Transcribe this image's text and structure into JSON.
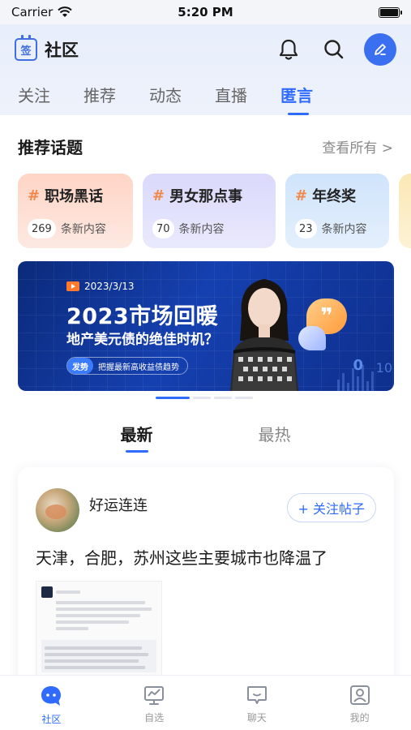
{
  "status_bar": {
    "carrier": "Carrier",
    "time": "5:20 PM"
  },
  "header": {
    "logo_glyph": "签",
    "title": "社区",
    "tabs": [
      "关注",
      "推荐",
      "动态",
      "直播",
      "匿言"
    ],
    "active_tab": "匿言"
  },
  "topics_section": {
    "title": "推荐话题",
    "see_all": "查看所有 >",
    "count_suffix": "条新内容",
    "items": [
      {
        "hash": "#",
        "name": "职场黑话",
        "count": "269"
      },
      {
        "hash": "#",
        "name": "男女那点事",
        "count": "70"
      },
      {
        "hash": "#",
        "name": "年终奖",
        "count": "23"
      }
    ]
  },
  "banner": {
    "date": "2023/3/13",
    "title": "2023市场回暖",
    "subtitle": "地产美元债的绝佳时机？",
    "tag_pill": "发势",
    "tag_text": "把握最新高收益债趋势",
    "bubble_glyph": "❞",
    "digit_a": "0",
    "digit_b": "10"
  },
  "feed_tabs": [
    "最新",
    "最热"
  ],
  "post": {
    "author": "好运连连",
    "follow_label": "+ 关注帖子",
    "text": "天津，合肥，苏州这些主要城市也降温了"
  },
  "tabbar": [
    {
      "label": "社区",
      "icon": "community-icon",
      "active": true
    },
    {
      "label": "自选",
      "icon": "watchlist-icon",
      "active": false
    },
    {
      "label": "聊天",
      "icon": "chat-icon",
      "active": false
    },
    {
      "label": "我的",
      "icon": "profile-icon",
      "active": false
    }
  ],
  "colors": {
    "accent": "#2f6bff",
    "topic_hash": "#f0884a"
  }
}
